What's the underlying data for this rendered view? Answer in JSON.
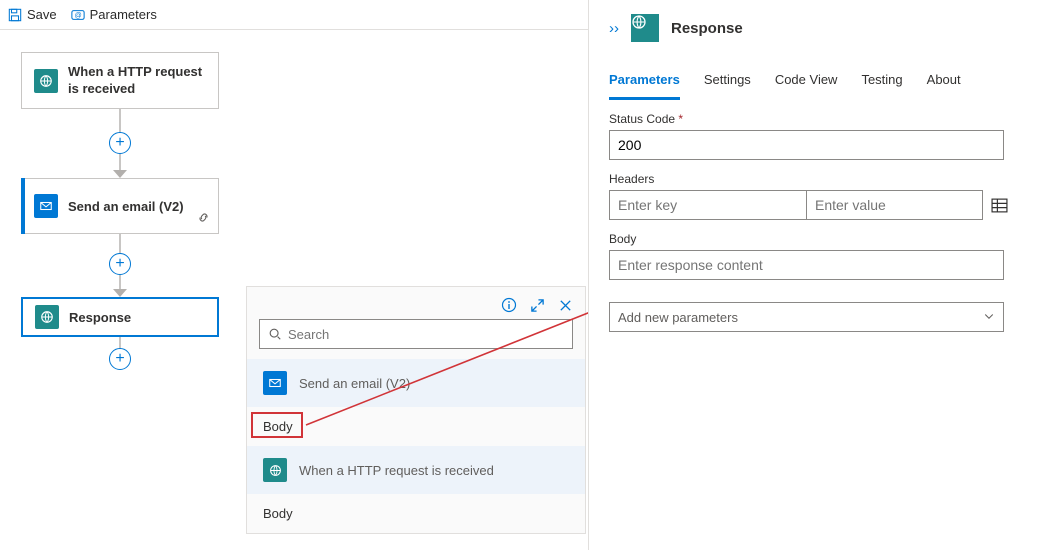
{
  "toolbar": {
    "save_label": "Save",
    "parameters_label": "Parameters"
  },
  "nodes": {
    "http": "When a HTTP request is received",
    "email": "Send an email (V2)",
    "response": "Response"
  },
  "picker": {
    "search_placeholder": "Search",
    "email_option": "Send an email (V2)",
    "email_body": "Body",
    "http_option": "When a HTTP request is received",
    "http_body": "Body"
  },
  "panel": {
    "title": "Response",
    "tabs": {
      "parameters": "Parameters",
      "settings": "Settings",
      "codeview": "Code View",
      "testing": "Testing",
      "about": "About"
    },
    "status_label": "Status Code",
    "status_value": "200",
    "headers_label": "Headers",
    "headers_key_placeholder": "Enter key",
    "headers_value_placeholder": "Enter value",
    "body_label": "Body",
    "body_placeholder": "Enter response content",
    "add_params": "Add new parameters"
  }
}
